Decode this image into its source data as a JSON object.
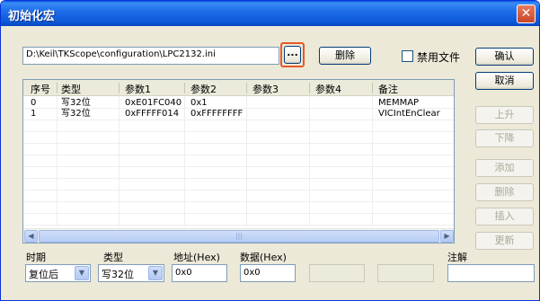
{
  "window": {
    "title": "初始化宏",
    "close_glyph": "✕"
  },
  "config_path": "D:\\Keil\\TKScope\\configuration\\LPC2132.ini",
  "buttons": {
    "browse": "...",
    "delete": "删除",
    "confirm": "确认",
    "cancel": "取消",
    "move_up": "上升",
    "move_down": "下降",
    "add": "添加",
    "remove": "删除",
    "insert": "插入",
    "update": "更新"
  },
  "disable_file_label": "禁用文件",
  "list": {
    "columns": [
      "序号",
      "类型",
      "参数1",
      "参数2",
      "参数3",
      "参数4",
      "备注"
    ],
    "rows": [
      [
        "0",
        "写32位",
        "0xE01FC040",
        "0x1",
        "",
        "",
        "MEMMAP"
      ],
      [
        "1",
        "写32位",
        "0xFFFFF014",
        "0xFFFFFFFF",
        "",
        "",
        "VICIntEnClear"
      ]
    ]
  },
  "editor": {
    "timing_label": "时期",
    "timing_value": "复位后",
    "type_label": "类型",
    "type_value": "写32位",
    "address_label": "地址(Hex)",
    "address_value": "0x0",
    "data_label": "数据(Hex)",
    "data_value": "0x0",
    "comment_label": "注解",
    "comment_value": ""
  },
  "icons": {
    "close": "close-icon",
    "chevron_down": "chevron-down-icon",
    "scroll_left": "scroll-left-icon",
    "scroll_right": "scroll-right-icon"
  }
}
